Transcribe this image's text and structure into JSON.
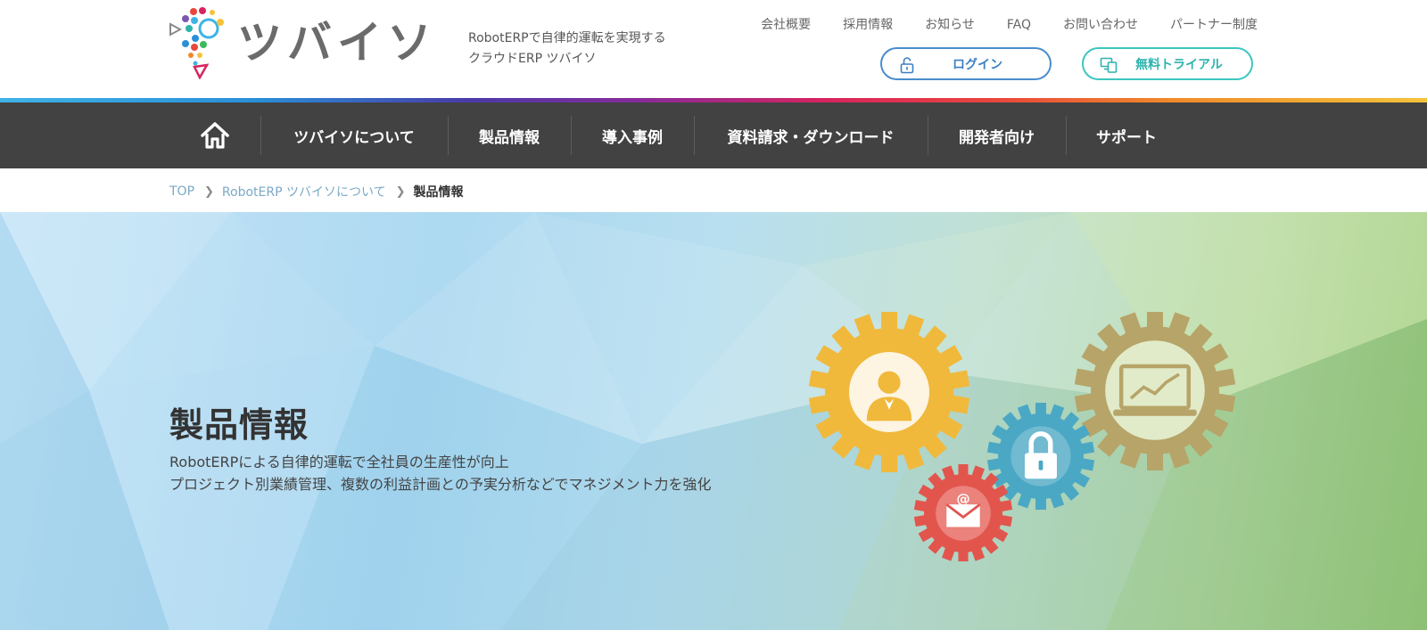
{
  "header": {
    "logo_text": "ツバイソ",
    "tagline": "RobotERPで自律的運転を実現する\nクラウドERP ツバイソ",
    "util_nav": [
      "会社概要",
      "採用情報",
      "お知らせ",
      "FAQ",
      "お問い合わせ",
      "パートナー制度"
    ],
    "login_label": "ログイン",
    "trial_label": "無料トライアル",
    "login_icon": "lock-open-icon",
    "trial_icon": "monitor-devices-icon"
  },
  "main_nav": {
    "home_icon": "home-icon",
    "items": [
      "ツバイソについて",
      "製品情報",
      "導入事例",
      "資料請求・ダウンロード",
      "開発者向け",
      "サポート"
    ]
  },
  "breadcrumb": {
    "items": [
      "TOP",
      "RobotERP ツバイソについて"
    ],
    "current": "製品情報"
  },
  "hero": {
    "title": "製品情報",
    "lead": "RobotERPによる自律的運転で全社員の生産性が向上\nプロジェクト別業績管理、複数の利益計画との予実分析などでマネジメント力を強化"
  },
  "colors": {
    "nav_bg": "#424242",
    "login_border": "#4a8ccc",
    "trial_border": "#3cc6c0",
    "breadcrumb_link": "#7aa9c6",
    "gear_yellow": "#f0b93c",
    "gear_blue": "#4aa8c4",
    "gear_red": "#e2554d",
    "gear_olive": "#b7a468"
  }
}
